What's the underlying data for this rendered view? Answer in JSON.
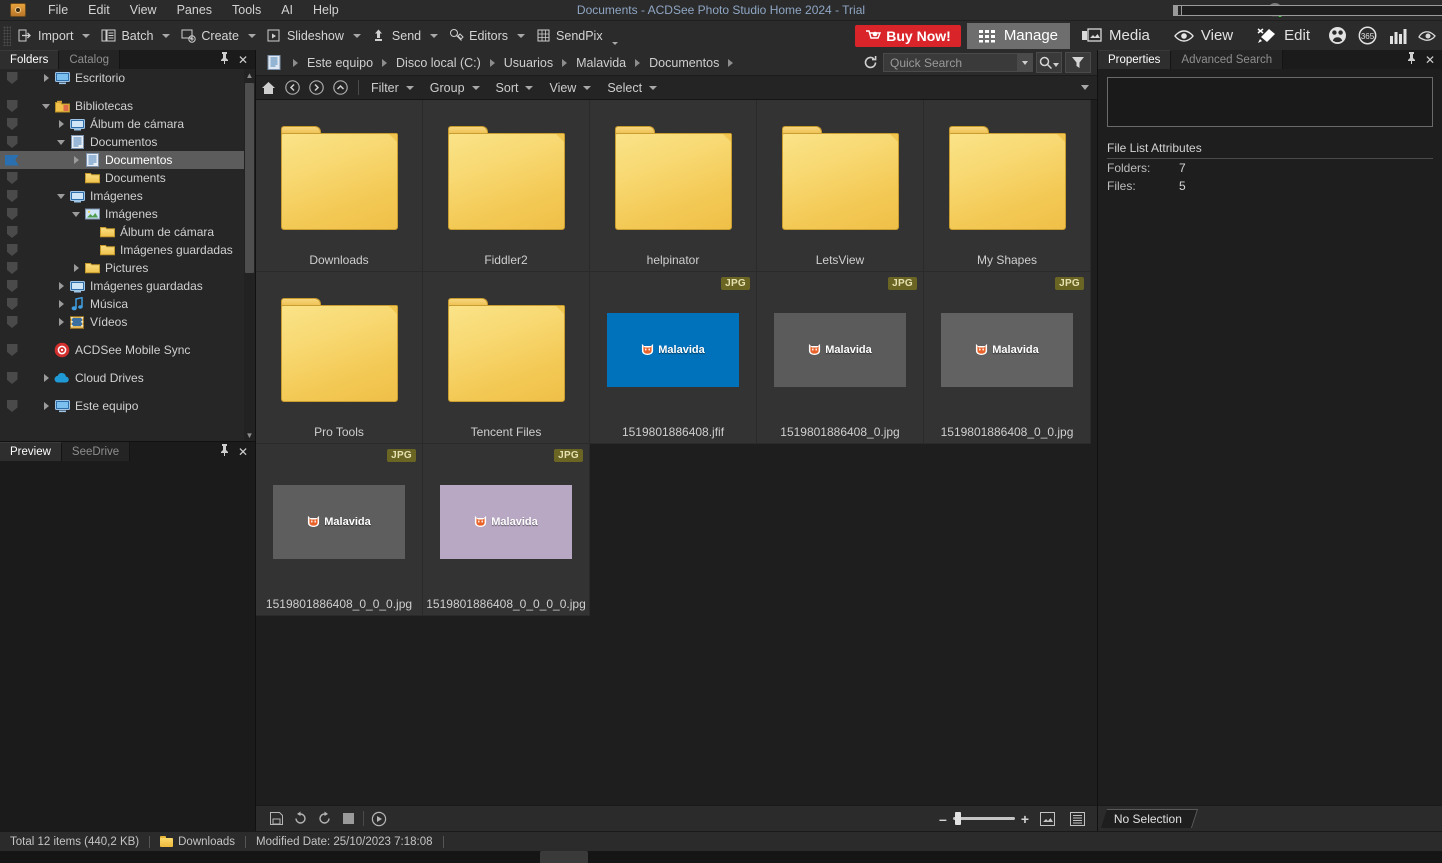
{
  "window": {
    "title": "Documents - ACDSee Photo Studio Home 2024 - Trial",
    "logo_icon": "acdsee-camera-logo",
    "minimize_label": "–",
    "restore_label": "❐",
    "close_label": "✕",
    "avatar_icon": "account-avatar-icon",
    "pane_toggles": [
      {
        "name": "left-pane-toggle",
        "icon": "panel-left-icon"
      },
      {
        "name": "bottom-pane-toggle",
        "icon": "panel-bottom-icon"
      },
      {
        "name": "right-pane-toggle",
        "icon": "panel-right-icon"
      }
    ]
  },
  "menu": {
    "items": [
      {
        "label": "File"
      },
      {
        "label": "Edit"
      },
      {
        "label": "View"
      },
      {
        "label": "Panes"
      },
      {
        "label": "Tools"
      },
      {
        "label": "AI"
      },
      {
        "label": "Help"
      }
    ]
  },
  "toolbar": {
    "buttons": [
      {
        "label": "Import",
        "icon": "import-icon",
        "has_caret": true
      },
      {
        "label": "Batch",
        "icon": "batch-icon",
        "has_caret": true
      },
      {
        "label": "Create",
        "icon": "create-icon",
        "has_caret": true
      },
      {
        "label": "Slideshow",
        "icon": "slideshow-icon",
        "has_caret": true
      },
      {
        "label": "Send",
        "icon": "send-icon",
        "has_caret": true
      },
      {
        "label": "Editors",
        "icon": "editors-icon",
        "has_caret": true
      },
      {
        "label": "SendPix",
        "icon": "sendpix-icon",
        "has_caret": true
      }
    ],
    "buy_now": {
      "label": "Buy Now!",
      "icon": "cart-icon",
      "color": "#d9242a"
    },
    "modes": [
      {
        "label": "Manage",
        "icon": "grid-icon",
        "active": true
      },
      {
        "label": "Media",
        "icon": "media-icon",
        "active": false
      },
      {
        "label": "View",
        "icon": "eye-icon",
        "active": false
      },
      {
        "label": "Edit",
        "icon": "edit-brush-icon",
        "active": false
      }
    ],
    "extra_icons": [
      {
        "name": "people-icon"
      },
      {
        "name": "365-icon"
      },
      {
        "name": "chart-icon"
      },
      {
        "name": "eye-dark-icon"
      }
    ]
  },
  "left_panel": {
    "tabs": [
      {
        "label": "Folders",
        "active": true
      },
      {
        "label": "Catalog",
        "active": false
      }
    ],
    "pin_icon": "pin-icon",
    "close_icon": "close-icon",
    "tree": [
      {
        "label": "Escritorio",
        "indent": 1,
        "arrow": "right",
        "icon": "desktop-icon",
        "selected": false
      },
      {
        "label": "",
        "indent": 0,
        "arrow": "none",
        "icon": "none",
        "spacer": true,
        "selected": false
      },
      {
        "label": "Bibliotecas",
        "indent": 1,
        "arrow": "down",
        "icon": "libraries-icon",
        "selected": false
      },
      {
        "label": "Álbum de cámara",
        "indent": 2,
        "arrow": "right",
        "icon": "library-icon",
        "selected": false
      },
      {
        "label": "Documentos",
        "indent": 2,
        "arrow": "down",
        "icon": "documents-icon",
        "selected": false
      },
      {
        "label": "Documentos",
        "indent": 3,
        "arrow": "right",
        "icon": "documents-icon",
        "selected": true
      },
      {
        "label": "Documents",
        "indent": 3,
        "arrow": "none",
        "icon": "folder-icon",
        "selected": false
      },
      {
        "label": "Imágenes",
        "indent": 2,
        "arrow": "down",
        "icon": "library-icon",
        "selected": false
      },
      {
        "label": "Imágenes",
        "indent": 3,
        "arrow": "down",
        "icon": "pictures-icon",
        "selected": false
      },
      {
        "label": "Álbum de cámara",
        "indent": 4,
        "arrow": "none",
        "icon": "folder-icon",
        "selected": false
      },
      {
        "label": "Imágenes guardadas",
        "indent": 4,
        "arrow": "none",
        "icon": "folder-icon",
        "selected": false
      },
      {
        "label": "Pictures",
        "indent": 3,
        "arrow": "right",
        "icon": "folder-icon",
        "selected": false
      },
      {
        "label": "Imágenes guardadas",
        "indent": 2,
        "arrow": "right",
        "icon": "library-icon",
        "selected": false
      },
      {
        "label": "Música",
        "indent": 2,
        "arrow": "right",
        "icon": "music-icon",
        "selected": false
      },
      {
        "label": "Vídeos",
        "indent": 2,
        "arrow": "right",
        "icon": "videos-icon",
        "selected": false
      },
      {
        "label": "",
        "indent": 0,
        "arrow": "none",
        "icon": "none",
        "spacer": true,
        "selected": false
      },
      {
        "label": "ACDSee Mobile Sync",
        "indent": 1,
        "arrow": "none",
        "icon": "mobile-sync-icon",
        "selected": false
      },
      {
        "label": "",
        "indent": 0,
        "arrow": "none",
        "icon": "none",
        "spacer": true,
        "selected": false
      },
      {
        "label": "Cloud Drives",
        "indent": 1,
        "arrow": "right",
        "icon": "cloud-icon",
        "selected": false
      },
      {
        "label": "",
        "indent": 0,
        "arrow": "none",
        "icon": "none",
        "spacer": true,
        "selected": false
      },
      {
        "label": "Este equipo",
        "indent": 1,
        "arrow": "right",
        "icon": "computer-icon",
        "selected": false
      }
    ]
  },
  "preview_panel": {
    "tabs": [
      {
        "label": "Preview",
        "active": true
      },
      {
        "label": "SeeDrive",
        "active": false
      }
    ],
    "pin_icon": "pin-icon",
    "close_icon": "close-icon"
  },
  "navbar": {
    "path_icon": "path-documents-icon",
    "breadcrumbs": [
      "Este equipo",
      "Disco local (C:)",
      "Usuarios",
      "Malavida",
      "Documentos"
    ],
    "refresh_icon": "refresh-icon",
    "search": {
      "placeholder": "Quick Search",
      "value": "",
      "dropdown_icon": "chevron-down-icon",
      "search_icon": "search-icon",
      "filter_icon": "funnel-icon"
    }
  },
  "filterbar": {
    "nav_icons": [
      {
        "name": "home-icon"
      },
      {
        "name": "back-icon"
      },
      {
        "name": "forward-icon"
      },
      {
        "name": "up-icon"
      }
    ],
    "menus": [
      {
        "label": "Filter"
      },
      {
        "label": "Group"
      },
      {
        "label": "Sort"
      },
      {
        "label": "View"
      },
      {
        "label": "Select"
      }
    ],
    "collapse_icon": "chevron-down-icon"
  },
  "files": [
    {
      "name": "Downloads",
      "type": "folder",
      "badge": null,
      "thumb_color": null
    },
    {
      "name": "Fiddler2",
      "type": "folder",
      "badge": null,
      "thumb_color": null
    },
    {
      "name": "helpinator",
      "type": "folder",
      "badge": null,
      "thumb_color": null
    },
    {
      "name": "LetsView",
      "type": "folder",
      "badge": null,
      "thumb_color": null
    },
    {
      "name": "My Shapes",
      "type": "folder",
      "badge": null,
      "thumb_color": null
    },
    {
      "name": "Pro Tools",
      "type": "folder",
      "badge": null,
      "thumb_color": null
    },
    {
      "name": "Tencent Files",
      "type": "folder",
      "badge": null,
      "thumb_color": null
    },
    {
      "name": "1519801886408.jfif",
      "type": "image",
      "badge": "JPG",
      "thumb_color": "#0072bb",
      "watermark": "Malavida"
    },
    {
      "name": "1519801886408_0.jpg",
      "type": "image",
      "badge": "JPG",
      "thumb_color": "#5b5b5b",
      "watermark": "Malavida"
    },
    {
      "name": "1519801886408_0_0.jpg",
      "type": "image",
      "badge": "JPG",
      "thumb_color": "#626262",
      "watermark": "Malavida"
    },
    {
      "name": "1519801886408_0_0_0.jpg",
      "type": "image",
      "badge": "JPG",
      "thumb_color": "#5e5e5e",
      "watermark": "Malavida"
    },
    {
      "name": "1519801886408_0_0_0_0.jpg",
      "type": "image",
      "badge": "#b9a8c4",
      "thumb_color": "#b9a8c4",
      "watermark": "Malavida",
      "badge_label": "JPG"
    }
  ],
  "grid_toolbar": {
    "icons": [
      {
        "name": "save-image-icon"
      },
      {
        "name": "rotate-left-icon"
      },
      {
        "name": "rotate-right-icon"
      },
      {
        "name": "stop-icon"
      },
      {
        "name": "play-circle-icon"
      }
    ],
    "zoom": {
      "minus_label": "–",
      "plus_label": "+",
      "value": 10
    },
    "view_icons": [
      {
        "name": "thumbnail-view-icon"
      },
      {
        "name": "list-view-icon"
      }
    ]
  },
  "right_panel": {
    "tabs": [
      {
        "label": "Properties",
        "active": true
      },
      {
        "label": "Advanced Search",
        "active": false
      }
    ],
    "pin_icon": "pin-icon",
    "close_icon": "close-icon",
    "section_title": "File List Attributes",
    "attributes": [
      {
        "key": "Folders:",
        "value": "7"
      },
      {
        "key": "Files:",
        "value": "5"
      }
    ],
    "selection_status": "No Selection"
  },
  "statusbar": {
    "total": "Total 12 items  (440,2 KB)",
    "folder_icon": "folder-icon",
    "folder_name": "Downloads",
    "modified": "Modified Date: 25/10/2023 7:18:08"
  }
}
